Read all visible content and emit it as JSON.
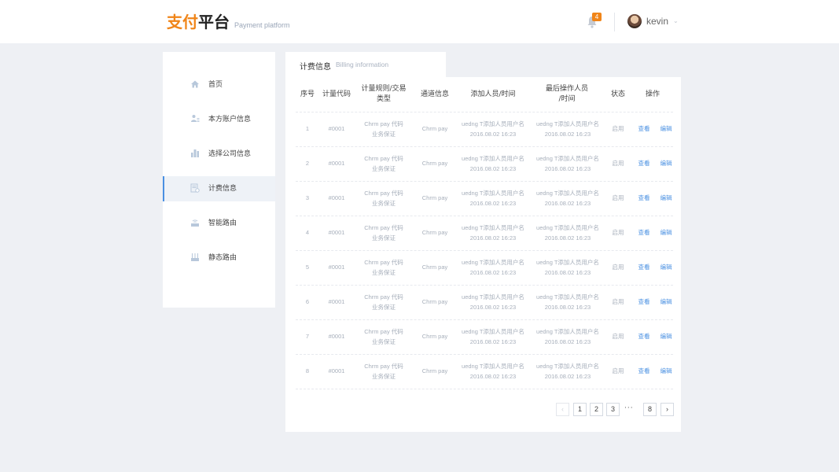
{
  "header": {
    "logo_orange": "支付",
    "logo_black": "平台",
    "logo_sub": "Payment platform",
    "notification_count": "4",
    "user_name": "kevin"
  },
  "sidebar": {
    "items": [
      {
        "label": "首页",
        "icon": "home-icon"
      },
      {
        "label": "本方账户信息",
        "icon": "user-account-icon"
      },
      {
        "label": "选择公司信息",
        "icon": "company-building-icon"
      },
      {
        "label": "计费信息",
        "icon": "billing-doc-icon",
        "active": true
      },
      {
        "label": "智能路由",
        "icon": "router-icon"
      },
      {
        "label": "静态路由",
        "icon": "static-route-icon"
      }
    ]
  },
  "tab": {
    "title": "计费信息",
    "subtitle": "Billing information"
  },
  "table": {
    "headers": {
      "index": "序号",
      "code": "计量代码",
      "rule_line1": "计量规则/交易",
      "rule_line2": "类型",
      "channel": "通道信息",
      "added_by": "添加人员/时间",
      "last_op_line1": "最后操作人员",
      "last_op_line2": "/时间",
      "status": "状态",
      "actions": "操作"
    },
    "rows": [
      {
        "index": "1",
        "code": "#0001",
        "rule_line1": "Chrm pay 代码",
        "rule_line2": "业务保证",
        "channel": "Chrm pay",
        "added_line1": "uedng T添加人员用户名",
        "added_line2": "2016.08.02 16:23",
        "last_line1": "uedng T添加人员用户名",
        "last_line2": "2016.08.02 16:23",
        "status": "启用",
        "view": "查看",
        "edit": "编辑"
      },
      {
        "index": "2",
        "code": "#0001",
        "rule_line1": "Chrm pay 代码",
        "rule_line2": "业务保证",
        "channel": "Chrm pay",
        "added_line1": "uedng T添加人员用户名",
        "added_line2": "2016.08.02 16:23",
        "last_line1": "uedng T添加人员用户名",
        "last_line2": "2016.08.02 16:23",
        "status": "启用",
        "view": "查看",
        "edit": "编辑"
      },
      {
        "index": "3",
        "code": "#0001",
        "rule_line1": "Chrm pay 代码",
        "rule_line2": "业务保证",
        "channel": "Chrm pay",
        "added_line1": "uedng T添加人员用户名",
        "added_line2": "2016.08.02 16:23",
        "last_line1": "uedng T添加人员用户名",
        "last_line2": "2016.08.02 16:23",
        "status": "启用",
        "view": "查看",
        "edit": "编辑"
      },
      {
        "index": "4",
        "code": "#0001",
        "rule_line1": "Chrm pay 代码",
        "rule_line2": "业务保证",
        "channel": "Chrm pay",
        "added_line1": "uedng T添加人员用户名",
        "added_line2": "2016.08.02 16:23",
        "last_line1": "uedng T添加人员用户名",
        "last_line2": "2016.08.02 16:23",
        "status": "启用",
        "view": "查看",
        "edit": "编辑"
      },
      {
        "index": "5",
        "code": "#0001",
        "rule_line1": "Chrm pay 代码",
        "rule_line2": "业务保证",
        "channel": "Chrm pay",
        "added_line1": "uedng T添加人员用户名",
        "added_line2": "2016.08.02 16:23",
        "last_line1": "uedng T添加人员用户名",
        "last_line2": "2016.08.02 16:23",
        "status": "启用",
        "view": "查看",
        "edit": "编辑"
      },
      {
        "index": "6",
        "code": "#0001",
        "rule_line1": "Chrm pay 代码",
        "rule_line2": "业务保证",
        "channel": "Chrm pay",
        "added_line1": "uedng T添加人员用户名",
        "added_line2": "2016.08.02 16:23",
        "last_line1": "uedng T添加人员用户名",
        "last_line2": "2016.08.02 16:23",
        "status": "启用",
        "view": "查看",
        "edit": "编辑"
      },
      {
        "index": "7",
        "code": "#0001",
        "rule_line1": "Chrm pay 代码",
        "rule_line2": "业务保证",
        "channel": "Chrm pay",
        "added_line1": "uedng T添加人员用户名",
        "added_line2": "2016.08.02 16:23",
        "last_line1": "uedng T添加人员用户名",
        "last_line2": "2016.08.02 16:23",
        "status": "启用",
        "view": "查看",
        "edit": "编辑"
      },
      {
        "index": "8",
        "code": "#0001",
        "rule_line1": "Chrm pay 代码",
        "rule_line2": "业务保证",
        "channel": "Chrm pay",
        "added_line1": "uedng T添加人员用户名",
        "added_line2": "2016.08.02 16:23",
        "last_line1": "uedng T添加人员用户名",
        "last_line2": "2016.08.02 16:23",
        "status": "启用",
        "view": "查看",
        "edit": "编辑"
      }
    ]
  },
  "pagination": {
    "prev": "‹",
    "pages": [
      "1",
      "2",
      "3"
    ],
    "ellipsis": "···",
    "last": "8",
    "next": "›"
  }
}
